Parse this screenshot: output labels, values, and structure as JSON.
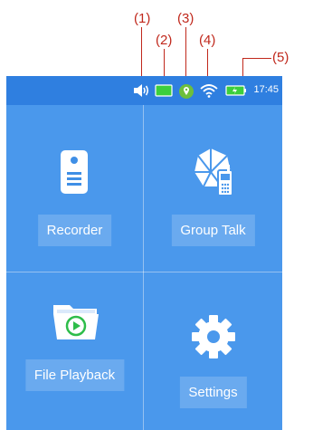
{
  "callouts": [
    "(1)",
    "(2)",
    "(3)",
    "(4)",
    "(5)"
  ],
  "status_bar": {
    "icons": [
      "speaker-icon",
      "camera-status-icon",
      "gps-icon",
      "wifi-icon",
      "battery-icon"
    ],
    "time": "17:45",
    "colors": {
      "bar": "#2f7fe0",
      "camera": "#3ccf3c",
      "gps": "#6dbf3c",
      "battery": "#3ccf3c"
    }
  },
  "apps": [
    {
      "label": "Recorder",
      "icon": "recorder-icon"
    },
    {
      "label": "Group Talk",
      "icon": "group-talk-icon"
    },
    {
      "label": "File Playback",
      "icon": "file-playback-icon"
    },
    {
      "label": "Settings",
      "icon": "settings-gear-icon"
    }
  ],
  "colors": {
    "screen_bg": "#3f8fe6",
    "callout": "#c0281c"
  }
}
